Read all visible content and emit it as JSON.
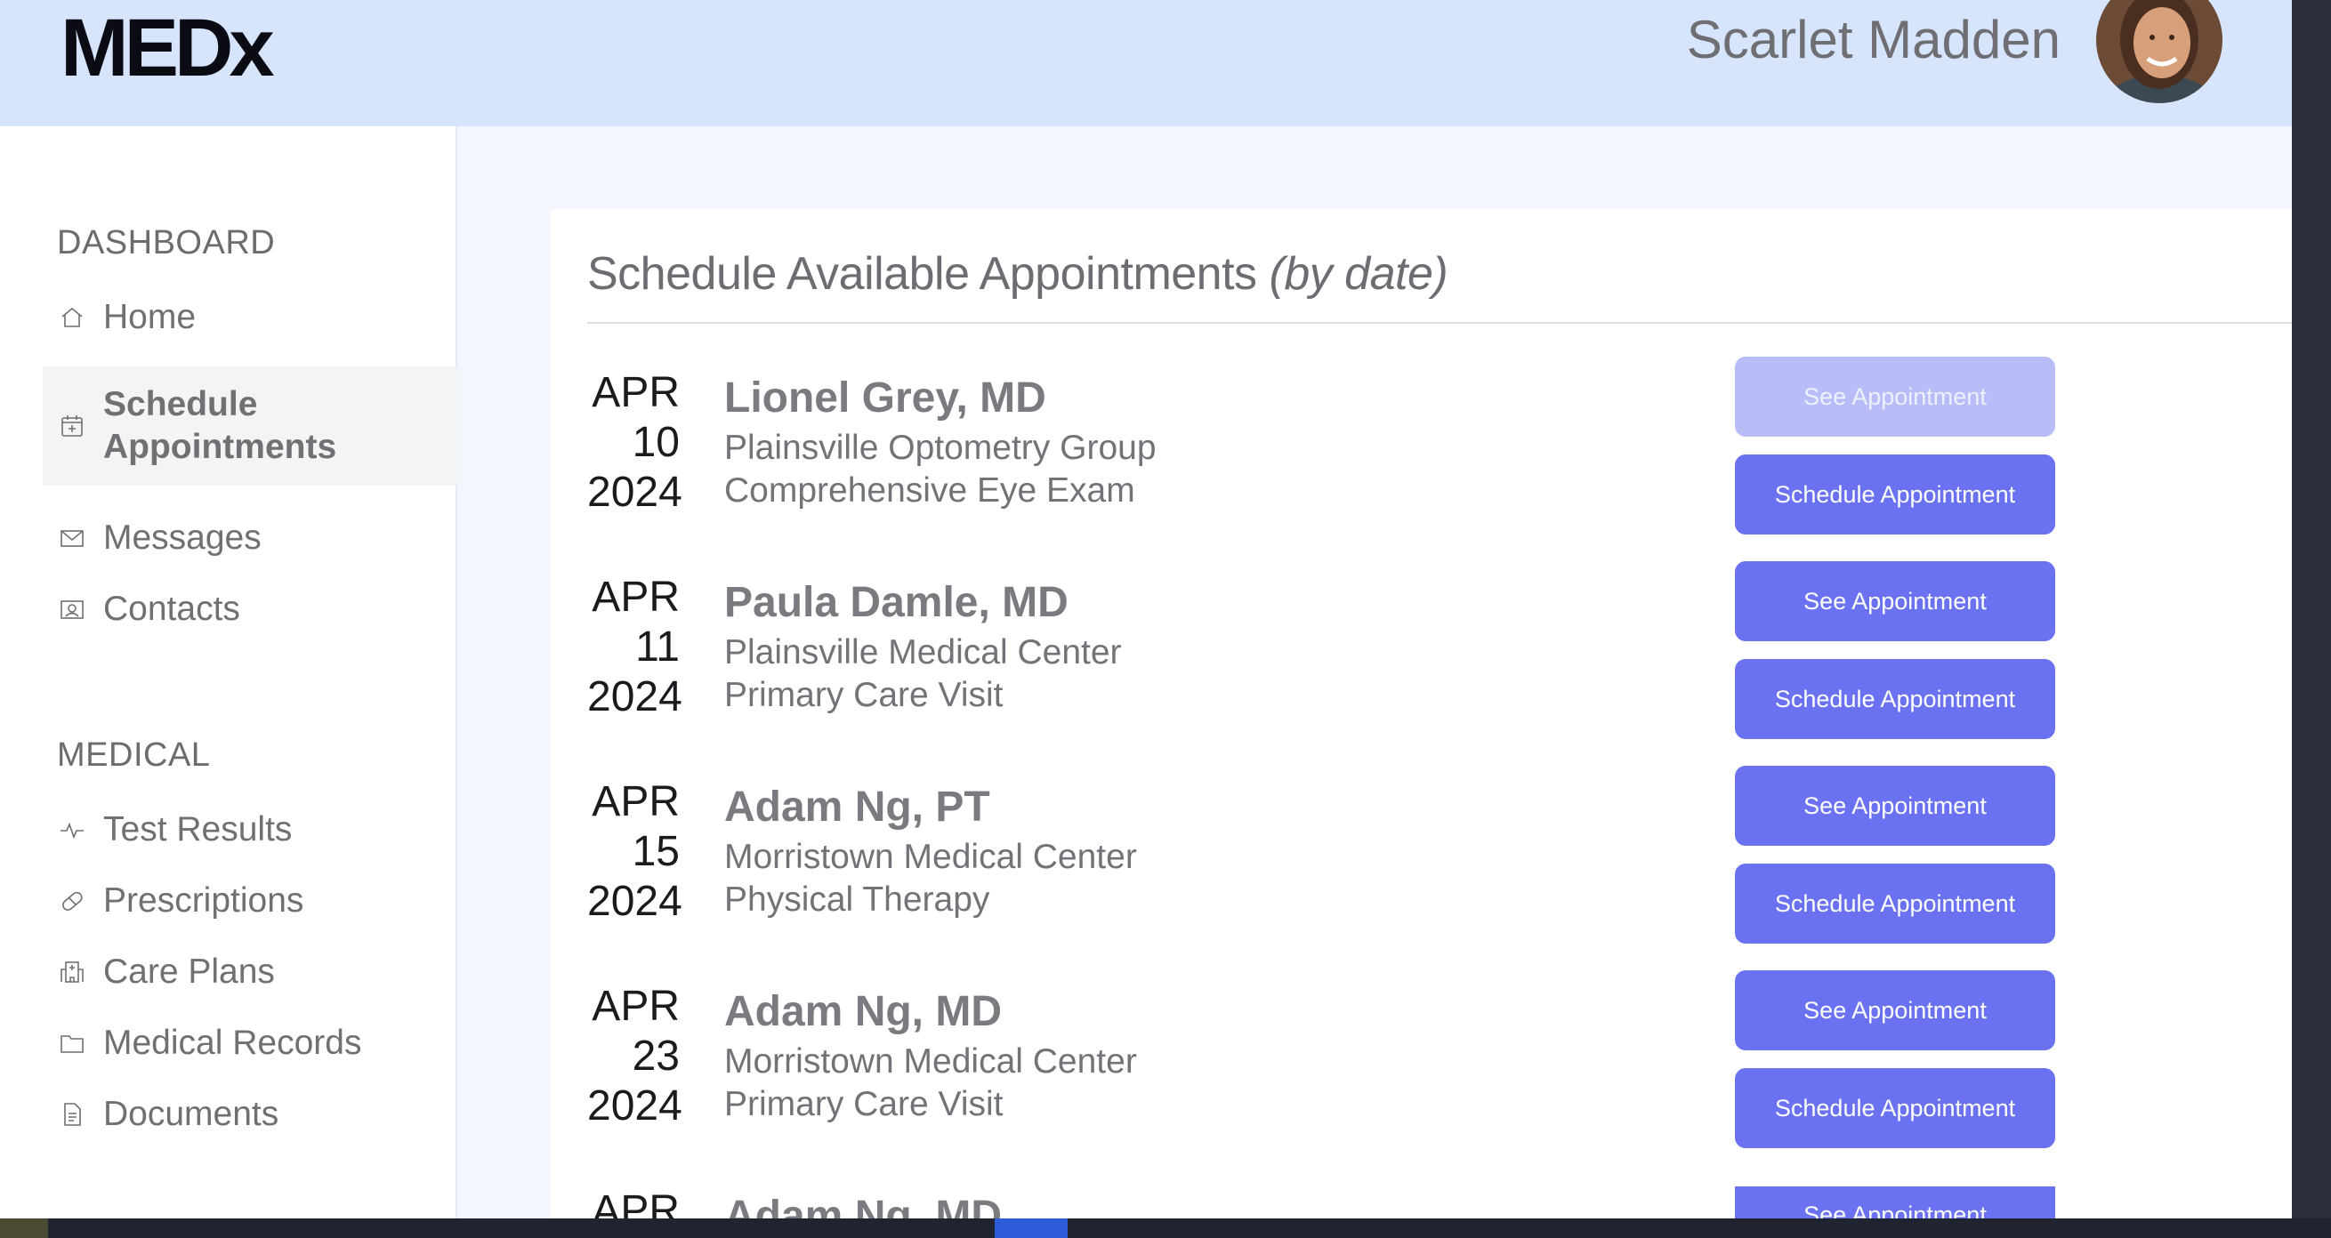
{
  "header": {
    "logo": "MEDx",
    "user_name": "Scarlet Madden"
  },
  "sidebar": {
    "dashboard_title": "DASHBOARD",
    "dashboard_items": [
      {
        "label": "Home",
        "icon": "home-icon"
      },
      {
        "label": "Schedule Appointments",
        "icon": "calendar-plus-icon",
        "active": true
      },
      {
        "label": "Messages",
        "icon": "envelope-icon"
      },
      {
        "label": "Contacts",
        "icon": "contact-card-icon"
      }
    ],
    "medical_title": "MEDICAL",
    "medical_items": [
      {
        "label": "Test Results",
        "icon": "pulse-icon"
      },
      {
        "label": "Prescriptions",
        "icon": "pill-icon"
      },
      {
        "label": "Care Plans",
        "icon": "hospital-icon"
      },
      {
        "label": "Medical Records",
        "icon": "folder-icon"
      },
      {
        "label": "Documents",
        "icon": "document-icon"
      }
    ]
  },
  "main": {
    "title": "Schedule Available Appointments",
    "title_suffix": "(by date)",
    "see_label": "See Appointment",
    "schedule_label": "Schedule Appointment",
    "appointments": [
      {
        "month": "APR",
        "day": "10",
        "year": "2024",
        "doctor": "Lionel Grey, MD",
        "location": "Plainsville Optometry Group",
        "type": "Comprehensive Eye Exam"
      },
      {
        "month": "APR",
        "day": "11",
        "year": "2024",
        "doctor": "Paula Damle, MD",
        "location": "Plainsville Medical Center",
        "type": "Primary Care Visit"
      },
      {
        "month": "APR",
        "day": "15",
        "year": "2024",
        "doctor": "Adam Ng, PT",
        "location": "Morristown Medical Center",
        "type": "Physical Therapy"
      },
      {
        "month": "APR",
        "day": "23",
        "year": "2024",
        "doctor": "Adam Ng, MD",
        "location": "Morristown Medical Center",
        "type": "Primary Care Visit"
      },
      {
        "month": "APR",
        "doctor": "Adam Ng, MD"
      }
    ]
  },
  "colors": {
    "header_bg": "#d6e4fc",
    "button_primary": "#6b72f2",
    "button_faded": "#b9bdf7"
  }
}
